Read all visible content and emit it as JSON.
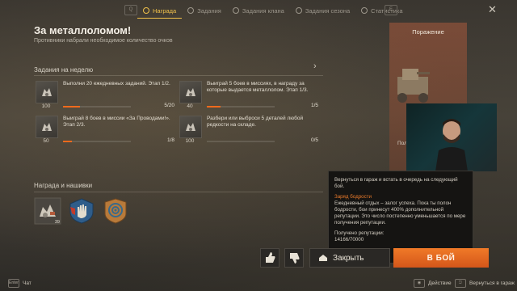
{
  "topbar": {
    "key_left": "Q",
    "key_right": "E",
    "tabs": [
      {
        "label": "Награда",
        "active": true
      },
      {
        "label": "Задания",
        "active": false
      },
      {
        "label": "Задания клана",
        "active": false
      },
      {
        "label": "Задания сезона",
        "active": false
      },
      {
        "label": "Статистика",
        "active": false
      }
    ]
  },
  "header": {
    "title": "За металлоломом!",
    "subtitle": "Противники набрали необходимое количество очков"
  },
  "weekly": {
    "label": "Задания на неделю",
    "tasks": [
      {
        "reward": "100",
        "text": "Выполни 20 ежедневных заданий. Этап 1/2.",
        "progress": "5/20",
        "fraction": 0.25
      },
      {
        "reward": "40",
        "text": "Выиграй 5 боев в миссиях, в награду за которые выдается металлолом. Этап 1/3.",
        "progress": "1/5",
        "fraction": 0.2
      },
      {
        "reward": "50",
        "text": "Выиграй 8 боев в миссии «За Проводами!». Этап 2/3.",
        "progress": "1/8",
        "fraction": 0.125
      },
      {
        "reward": "100",
        "text": "Разбери или выброси 5 деталей любой редкости на складе.",
        "progress": "0/5",
        "fraction": 0.0
      }
    ]
  },
  "rewards": {
    "label": "Награда и нашивки",
    "items": [
      {
        "icon": "scrap-icon",
        "count": "39"
      },
      {
        "icon": "hand-badge-icon",
        "count": ""
      },
      {
        "icon": "target-badge-icon",
        "count": ""
      }
    ]
  },
  "side": {
    "result": "Поражение",
    "small": "Пол"
  },
  "tooltip": {
    "p1": "Вернуться в гараж и встать в очередь на следующий бой.",
    "heading": "Заряд бодрости",
    "body": "Ежедневный отдых – залог успеха. Пока ты полон бодрости, бои принесут 400% дополнительной репутации. Это число постепенно уменьшается по мере получения репутации.",
    "rep_label": "Получено репутации:",
    "rep_value": "14166/70000"
  },
  "actions": {
    "close_label": "Закрыть",
    "battle_label": "В БОЙ"
  },
  "bottom": {
    "chat_key": "Enter",
    "chat_label": "Чат",
    "action_label": "Действие",
    "back_label": "Вернуться в гараж"
  },
  "colors": {
    "accent": "#f06a1c",
    "active_tab": "#f0c04a",
    "defeat_panel": "#a85a3c"
  }
}
